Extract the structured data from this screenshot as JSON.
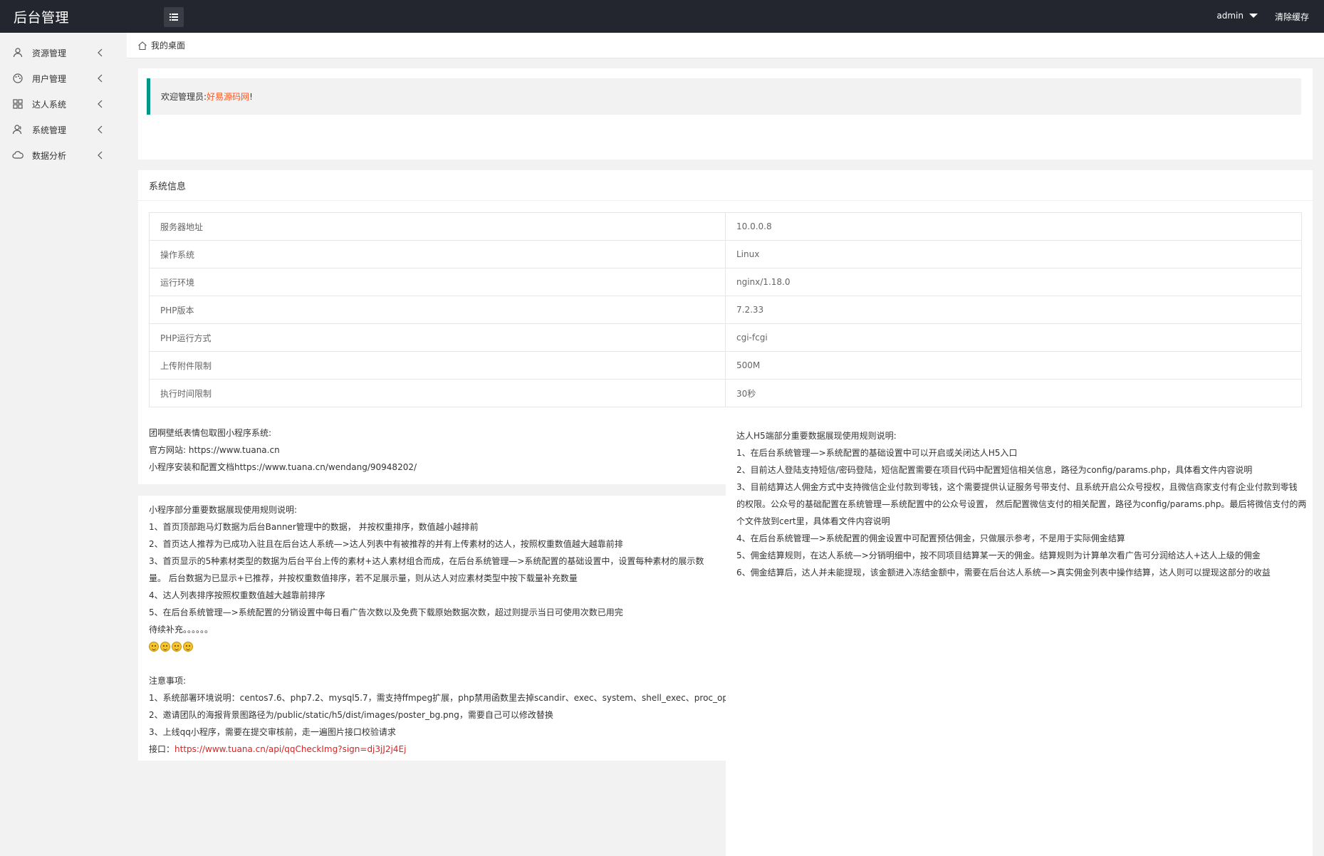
{
  "header": {
    "logo": "后台管理",
    "user": "admin",
    "clear_cache": "清除缓存"
  },
  "sidebar": {
    "items": [
      {
        "label": "资源管理",
        "icon": "user-icon"
      },
      {
        "label": "用户管理",
        "icon": "palette-icon"
      },
      {
        "label": "达人系统",
        "icon": "grid-icon"
      },
      {
        "label": "系统管理",
        "icon": "user-group-icon"
      },
      {
        "label": "数据分析",
        "icon": "cloud-icon"
      }
    ]
  },
  "breadcrumb": {
    "text": "我的桌面"
  },
  "welcome": {
    "prefix": "欢迎管理员:",
    "site_name": "好易源码网",
    "suffix": "!"
  },
  "system_info": {
    "title": "系统信息",
    "rows": [
      {
        "label": "服务器地址",
        "value": "10.0.0.8"
      },
      {
        "label": "操作系统",
        "value": "Linux"
      },
      {
        "label": "运行环境",
        "value": "nginx/1.18.0"
      },
      {
        "label": "PHP版本",
        "value": "7.2.33"
      },
      {
        "label": "PHP运行方式",
        "value": "cgi-fcgi"
      },
      {
        "label": "上传附件限制",
        "value": "500M"
      },
      {
        "label": "执行时间限制",
        "value": "30秒"
      }
    ]
  },
  "intro": {
    "lines": [
      "团啊壁纸表情包取图小程序系统:",
      "官方网站: https://www.tuana.cn",
      "小程序安装和配置文档https://www.tuana.cn/wendang/90948202/"
    ]
  },
  "miniapp_rules": {
    "lines": [
      "小程序部分重要数据展现使用规则说明:",
      "1、首页顶部跑马灯数据为后台Banner管理中的数据， 并按权重排序，数值越小越排前",
      "2、首页达人推荐为已成功入驻且在后台达人系统—>达人列表中有被推荐的并有上传素材的达人，按照权重数值越大越靠前排",
      "3、首页显示的5种素材类型的数据为后台平台上传的素材+达人素材组合而成，在后台系统管理—>系统配置的基础设置中，设置每种素材的展示数",
      "量。 后台数据为已显示+已推荐，并按权重数值排序，若不足展示量，则从达人对应素材类型中按下载量补充数量",
      "4、达人列表排序按照权重数值越大越靠前排序",
      "5、在后台系统管理—>系统配置的分销设置中每日看广告次数以及免费下载原始数据次数，超过则提示当日可使用次数已用完",
      "待续补充。。。。。。"
    ],
    "notes_title": "注意事项:",
    "notes": [
      "1、系统部署环境说明：centos7.6、php7.2、mysql5.7，需支持ffmpeg扩展，php禁用函数里去掉scandir、exec、system、shell_exec、proc_open",
      "2、邀请团队的海报背景图路径为/public/static/h5/dist/images/poster_bg.png，需要自己可以修改替换",
      "3、上线qq小程序，需要在提交审核前，走一遍图片接口校验请求"
    ],
    "api_label": "接口：",
    "api_url": "https://www.tuana.cn/api/qqCheckImg?sign=dj3jJ2j4Ej"
  },
  "h5_rules": {
    "lines": [
      "达人H5端部分重要数据展现使用规则说明:",
      "1、在后台系统管理—>系统配置的基础设置中可以开启或关闭达人H5入口",
      "2、目前达人登陆支持短信/密码登陆，短信配置需要在项目代码中配置短信相关信息，路径为config/params.php，具体看文件内容说明",
      "3、目前结算达人佣金方式中支持微信企业付款到零钱，这个需要提供认证服务号带支付、且系统开启公众号授权，且微信商家支付有企业付款到零钱",
      "的权限。公众号的基础配置在系统管理—系统配置中的公众号设置， 然后配置微信支付的相关配置，路径为config/params.php。最后将微信支付的两",
      "个文件放到cert里，具体看文件内容说明",
      "4、在后台系统管理—>系统配置的佣金设置中可配置预估佣金，只做展示参考，不是用于实际佣金结算",
      "5、佣金结算规则，在达人系统—>分销明细中，按不同项目结算某一天的佣金。结算规则为计算单次看广告可分润给达人+达人上级的佣金",
      "6、佣金结算后，达人并未能提现，该金额进入冻结金额中，需要在后台达人系统—>真实佣金列表中操作结算，达人则可以提现这部分的收益"
    ]
  }
}
